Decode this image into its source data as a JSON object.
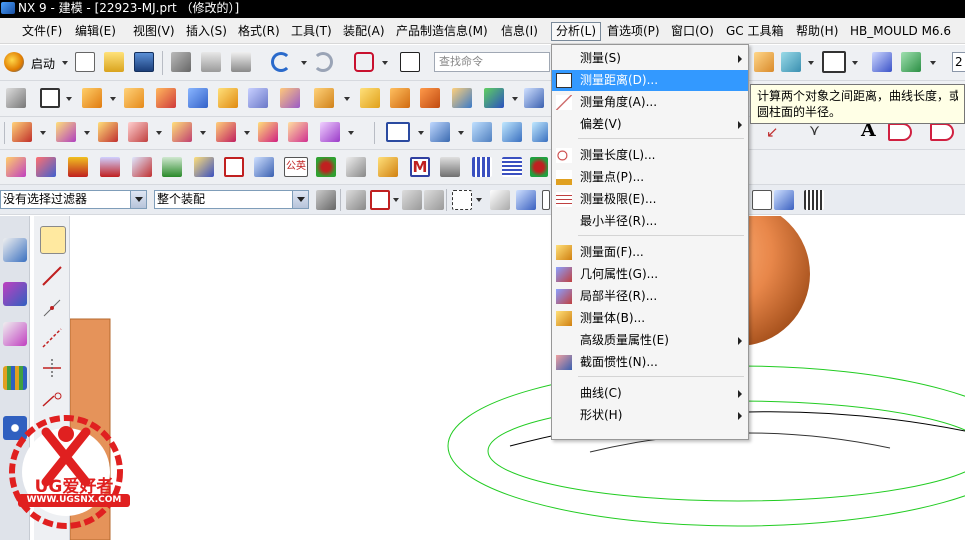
{
  "titlebar": {
    "title": "NX 9 - 建模 - [22923-MJ.prt （修改的）]"
  },
  "menubar": {
    "items": [
      {
        "label": "文件(F)"
      },
      {
        "label": "编辑(E)"
      },
      {
        "label": "视图(V)"
      },
      {
        "label": "插入(S)"
      },
      {
        "label": "格式(R)"
      },
      {
        "label": "工具(T)"
      },
      {
        "label": "装配(A)"
      },
      {
        "label": "产品制造信息(M)"
      },
      {
        "label": "信息(I)"
      },
      {
        "label": "分析(L)"
      },
      {
        "label": "首选项(P)"
      },
      {
        "label": "窗口(O)"
      },
      {
        "label": "GC 工具箱"
      },
      {
        "label": "帮助(H)"
      },
      {
        "label": "HB_MOULD M6.6"
      }
    ]
  },
  "toolbar": {
    "start_label": "启动",
    "search_placeholder": "查找命令",
    "right_value": "2"
  },
  "filters": {
    "selection_filter": "没有选择过滤器",
    "assembly_scope": "整个装配"
  },
  "analysis_menu": {
    "items": [
      {
        "label": "测量(S)",
        "submenu": true
      },
      {
        "label": "测量距离(D)...",
        "highlight": true
      },
      {
        "label": "测量角度(A)..."
      },
      {
        "label": "偏差(V)",
        "submenu": true
      },
      {
        "label": "测量长度(L)..."
      },
      {
        "label": "测量点(P)..."
      },
      {
        "label": "测量极限(E)..."
      },
      {
        "label": "最小半径(R)..."
      },
      {
        "label": "测量面(F)..."
      },
      {
        "label": "几何属性(G)..."
      },
      {
        "label": "局部半径(R)..."
      },
      {
        "label": "测量体(B)..."
      },
      {
        "label": "高级质量属性(E)",
        "submenu": true
      },
      {
        "label": "截面惯性(N)..."
      },
      {
        "label": "曲线(C)",
        "submenu": true
      },
      {
        "label": "形状(H)",
        "submenu": true
      }
    ]
  },
  "tooltip": {
    "line1": "计算两个对象之间距离，曲线长度，或者",
    "line2": "圆柱面的半径。"
  },
  "watermark": {
    "brand": "UG爱好者",
    "url": "WWW.UGSNX.COM"
  },
  "colors": {
    "highlight": "#3399ff",
    "menu_bg": "#f5f5f5",
    "tooltip_bg": "#ffffe6",
    "title_bg": "#000000",
    "watermark_red": "#e02020",
    "sphere_orange": "#e8874a",
    "block_orange": "#e5935a",
    "curve_green": "#22cc22"
  }
}
